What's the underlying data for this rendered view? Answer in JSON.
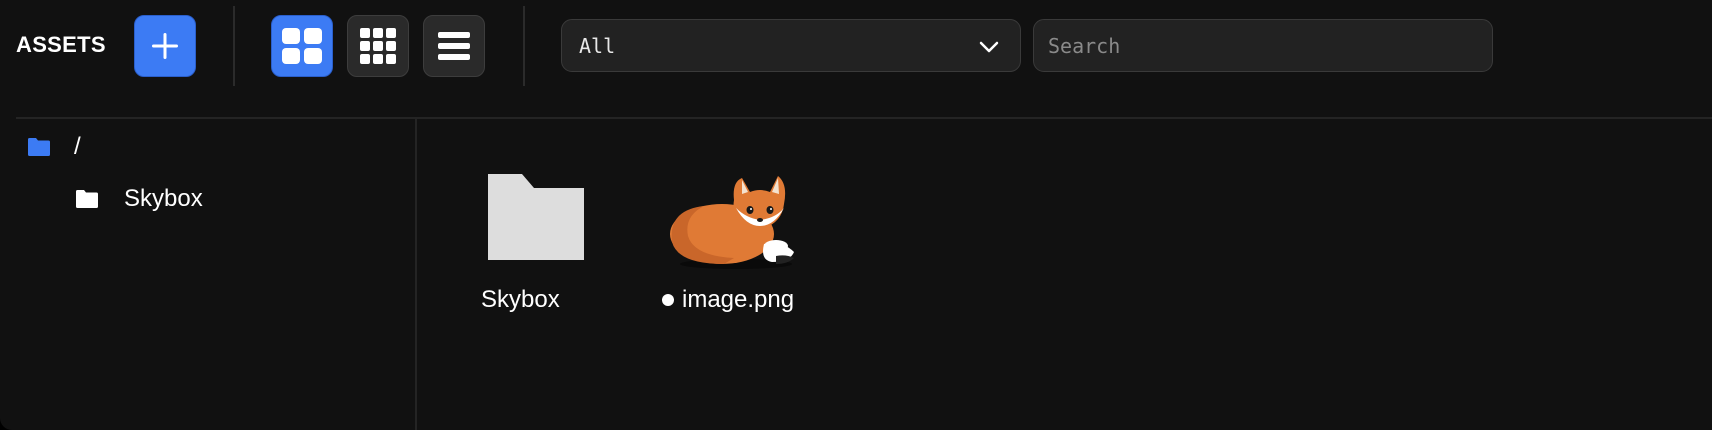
{
  "toolbar": {
    "title": "ASSETS",
    "filter": {
      "value": "All"
    },
    "search": {
      "placeholder": "Search",
      "value": ""
    }
  },
  "sidebar": {
    "root": {
      "label": "/"
    },
    "children": [
      {
        "label": "Skybox"
      }
    ]
  },
  "assets": [
    {
      "label": "Skybox",
      "kind": "folder"
    },
    {
      "label": "image.png",
      "kind": "image",
      "modified_dot": true
    }
  ],
  "colors": {
    "accent": "#3c7bf4",
    "background": "#111111",
    "folder_fill": "#dddddd"
  }
}
